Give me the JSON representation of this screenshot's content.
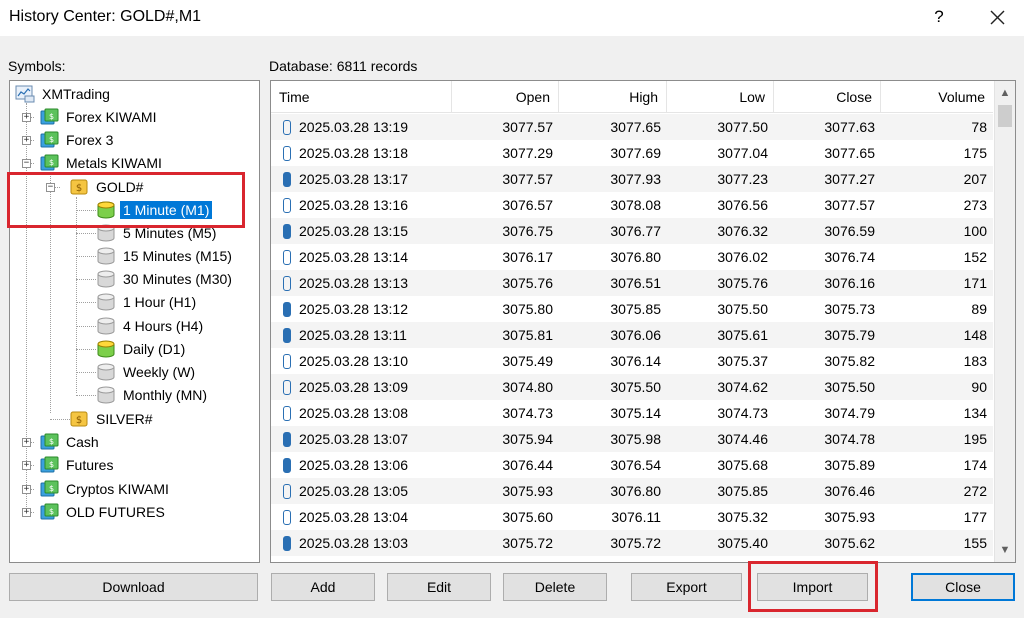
{
  "window": {
    "title": "History Center: GOLD#,M1",
    "help_label": "?"
  },
  "labels": {
    "symbols": "Symbols:",
    "database": "Database: 6811 records"
  },
  "tree": {
    "root": "XMTrading",
    "groups": [
      "Forex KIWAMI",
      "Forex 3",
      "Metals KIWAMI"
    ],
    "gold": "GOLD#",
    "timeframes": [
      "1 Minute (M1)",
      "5 Minutes (M5)",
      "15 Minutes (M15)",
      "30 Minutes (M30)",
      "1 Hour (H1)",
      "4 Hours (H4)",
      "Daily (D1)",
      "Weekly (W)",
      "Monthly (MN)"
    ],
    "silver": "SILVER#",
    "other_groups": [
      "Cash",
      "Futures",
      "Cryptos KIWAMI",
      "OLD FUTURES"
    ]
  },
  "table": {
    "columns": [
      "Time",
      "Open",
      "High",
      "Low",
      "Close",
      "Volume"
    ],
    "rows": [
      {
        "time": "2025.03.28 13:19",
        "open": "3077.57",
        "high": "3077.65",
        "low": "3077.50",
        "close": "3077.63",
        "volume": "78",
        "bull": true
      },
      {
        "time": "2025.03.28 13:18",
        "open": "3077.29",
        "high": "3077.69",
        "low": "3077.04",
        "close": "3077.65",
        "volume": "175",
        "bull": true
      },
      {
        "time": "2025.03.28 13:17",
        "open": "3077.57",
        "high": "3077.93",
        "low": "3077.23",
        "close": "3077.27",
        "volume": "207",
        "bull": false
      },
      {
        "time": "2025.03.28 13:16",
        "open": "3076.57",
        "high": "3078.08",
        "low": "3076.56",
        "close": "3077.57",
        "volume": "273",
        "bull": true
      },
      {
        "time": "2025.03.28 13:15",
        "open": "3076.75",
        "high": "3076.77",
        "low": "3076.32",
        "close": "3076.59",
        "volume": "100",
        "bull": false
      },
      {
        "time": "2025.03.28 13:14",
        "open": "3076.17",
        "high": "3076.80",
        "low": "3076.02",
        "close": "3076.74",
        "volume": "152",
        "bull": true
      },
      {
        "time": "2025.03.28 13:13",
        "open": "3075.76",
        "high": "3076.51",
        "low": "3075.76",
        "close": "3076.16",
        "volume": "171",
        "bull": true
      },
      {
        "time": "2025.03.28 13:12",
        "open": "3075.80",
        "high": "3075.85",
        "low": "3075.50",
        "close": "3075.73",
        "volume": "89",
        "bull": false
      },
      {
        "time": "2025.03.28 13:11",
        "open": "3075.81",
        "high": "3076.06",
        "low": "3075.61",
        "close": "3075.79",
        "volume": "148",
        "bull": false
      },
      {
        "time": "2025.03.28 13:10",
        "open": "3075.49",
        "high": "3076.14",
        "low": "3075.37",
        "close": "3075.82",
        "volume": "183",
        "bull": true
      },
      {
        "time": "2025.03.28 13:09",
        "open": "3074.80",
        "high": "3075.50",
        "low": "3074.62",
        "close": "3075.50",
        "volume": "90",
        "bull": true
      },
      {
        "time": "2025.03.28 13:08",
        "open": "3074.73",
        "high": "3075.14",
        "low": "3074.73",
        "close": "3074.79",
        "volume": "134",
        "bull": true
      },
      {
        "time": "2025.03.28 13:07",
        "open": "3075.94",
        "high": "3075.98",
        "low": "3074.46",
        "close": "3074.78",
        "volume": "195",
        "bull": false
      },
      {
        "time": "2025.03.28 13:06",
        "open": "3076.44",
        "high": "3076.54",
        "low": "3075.68",
        "close": "3075.89",
        "volume": "174",
        "bull": false
      },
      {
        "time": "2025.03.28 13:05",
        "open": "3075.93",
        "high": "3076.80",
        "low": "3075.85",
        "close": "3076.46",
        "volume": "272",
        "bull": true
      },
      {
        "time": "2025.03.28 13:04",
        "open": "3075.60",
        "high": "3076.11",
        "low": "3075.32",
        "close": "3075.93",
        "volume": "177",
        "bull": true
      },
      {
        "time": "2025.03.28 13:03",
        "open": "3075.72",
        "high": "3075.72",
        "low": "3075.40",
        "close": "3075.62",
        "volume": "155",
        "bull": false
      }
    ]
  },
  "buttons": {
    "download": "Download",
    "add": "Add",
    "edit": "Edit",
    "delete": "Delete",
    "export": "Export",
    "import": "Import",
    "close": "Close"
  },
  "colors": {
    "highlight": "#d9262e",
    "selection": "#0078d7",
    "candle": "#2a6fb3"
  }
}
